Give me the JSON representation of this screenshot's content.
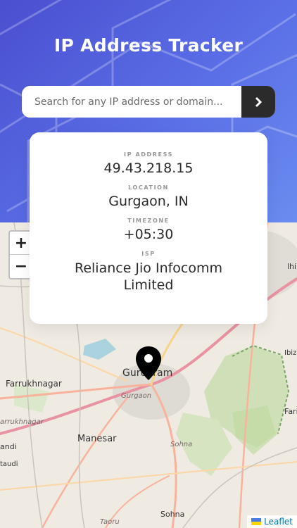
{
  "header": {
    "title": "IP Address Tracker"
  },
  "search": {
    "placeholder": "Search for any IP address or domain...",
    "value": ""
  },
  "info": {
    "ip": {
      "label": "IP ADDRESS",
      "value": "49.43.218.15"
    },
    "location": {
      "label": "LOCATION",
      "value": "Gurgaon, IN"
    },
    "timezone": {
      "label": "TIMEZONE",
      "value": "+05:30"
    },
    "isp": {
      "label": "ISP",
      "value": "Reliance Jio Infocomm Limited"
    }
  },
  "map": {
    "zoom_in": "+",
    "zoom_out": "−",
    "attribution": "Leaflet",
    "places": {
      "farrukhnagar": "Farrukhnagar",
      "gurugram": "Gurugram",
      "gurgaon": "Gurgaon",
      "manesar": "Manesar",
      "sohna": "Sohna",
      "sohna_road": "Sohna",
      "farrukhnagar_road": "arrukhnagar",
      "taoru": "Taoru",
      "pataudi": "taudi",
      "andi": "andi",
      "delhi": "lhi",
      "ibiz": "Ibiz",
      "farid": "Fari"
    }
  },
  "colors": {
    "accent": "#2b2b2b",
    "header_start": "#4a4fd0",
    "header_end": "#6b8cf0"
  }
}
